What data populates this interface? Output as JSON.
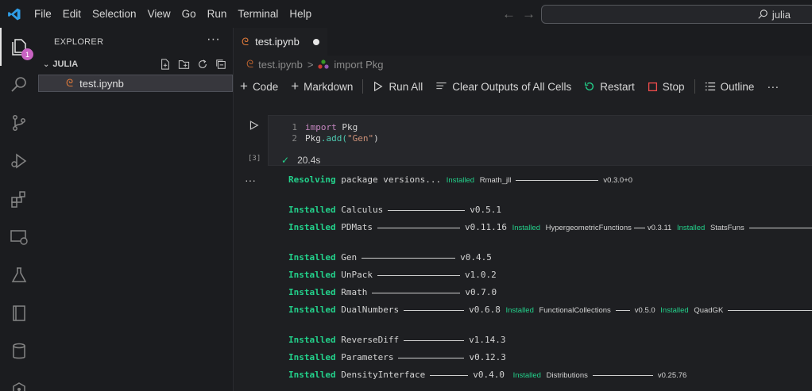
{
  "menu": [
    "File",
    "Edit",
    "Selection",
    "View",
    "Go",
    "Run",
    "Terminal",
    "Help"
  ],
  "search": {
    "text": "julia"
  },
  "activity": {
    "badge": "1"
  },
  "sidebar": {
    "title": "EXPLORER",
    "more": "···",
    "section": "JULIA",
    "file": "test.ipynb"
  },
  "tab": {
    "label": "test.ipynb"
  },
  "breadcrumb": {
    "file": "test.ipynb",
    "sep": ">",
    "symbol": "import Pkg"
  },
  "toolbar": {
    "code": "Code",
    "markdown": "Markdown",
    "run_all": "Run All",
    "clear": "Clear Outputs of All Cells",
    "restart": "Restart",
    "stop": "Stop",
    "outline": "Outline",
    "more": "···"
  },
  "cell": {
    "exec_count": "[3]",
    "duration": "20.4s",
    "line1_no": "1",
    "line1_kw": "import",
    "line1_rest": " Pkg",
    "line2_no": "2",
    "line2_obj": "Pkg",
    "line2_fn": ".add(",
    "line2_str": "\"Gen\"",
    "line2_end": ")",
    "output_more": "···"
  },
  "output": {
    "resolving_word": "Resolving",
    "resolving_rest": "package versions...",
    "rmath_jll_inst": "Installed",
    "rmath_jll": "Rmath_jll",
    "rmath_jll_v": "v0.3.0+0",
    "lines": [
      {
        "inst": "Installed",
        "pkg": "Calculus",
        "ver": "v0.5.1"
      },
      {
        "inst": "Installed",
        "pkg": "PDMats",
        "ver": "v0.11.16",
        "x1_inst": "Installed",
        "x1": "HypergeometricFunctions",
        "x1_v": "v0.3.11",
        "x2_inst": "Installed",
        "x2": "StatsFuns"
      },
      {
        "inst": "Installed",
        "pkg": "Gen",
        "ver": "v0.4.5"
      },
      {
        "inst": "Installed",
        "pkg": "UnPack",
        "ver": "v1.0.2"
      },
      {
        "inst": "Installed",
        "pkg": "Rmath",
        "ver": "v0.7.0"
      },
      {
        "inst": "Installed",
        "pkg": "DualNumbers",
        "ver": "v0.6.8",
        "x1_inst": "Installed",
        "x1": "FunctionalCollections",
        "x1_v": "v0.5.0",
        "x2_inst": "Installed",
        "x2": "QuadGK"
      },
      {
        "inst": "Installed",
        "pkg": "ReverseDiff",
        "ver": "v1.14.3"
      },
      {
        "inst": "Installed",
        "pkg": "Parameters",
        "ver": "v0.12.3"
      },
      {
        "inst": "Installed",
        "pkg": "DensityInterface",
        "ver": "v0.4.0",
        "x1_inst": "Installed",
        "x1": "Distributions",
        "x1_v": "v0.25.76"
      }
    ]
  },
  "colors": {
    "accent_green": "#23d18b",
    "badge": "#c862c2",
    "keyword": "#c586c0",
    "string": "#ce9178"
  }
}
